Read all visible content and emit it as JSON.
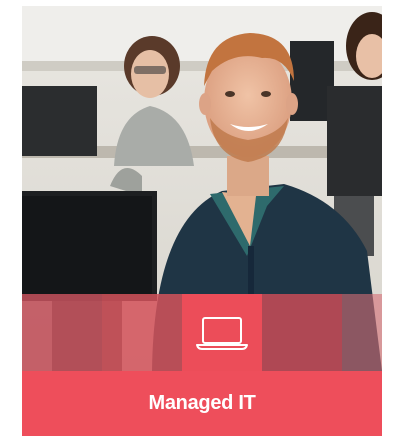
{
  "card": {
    "title": "Managed IT",
    "icon": "laptop-icon",
    "photo": "smiling-man-at-computer-in-classroom"
  },
  "colors": {
    "accent": "#ee4e5b",
    "band_left": "#c0505a",
    "band_mid": "#d4525b",
    "band_icon": "#ec4d59",
    "band_right": "#ca4c57",
    "text": "#ffffff"
  }
}
